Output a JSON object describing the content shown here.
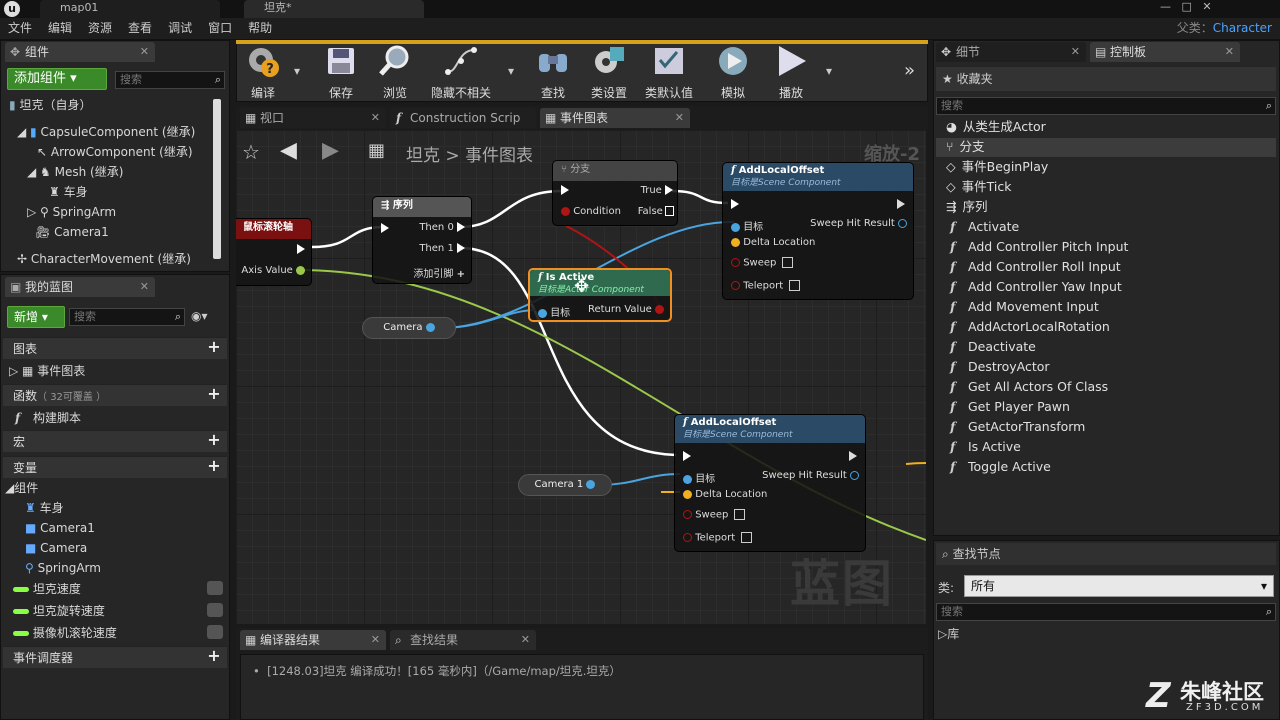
{
  "titlebar": {
    "tab1": "map01",
    "tab2": "坦克*"
  },
  "menu": [
    "文件",
    "编辑",
    "资源",
    "查看",
    "调试",
    "窗口",
    "帮助"
  ],
  "parent_class": {
    "label": "父类：",
    "value": "Character"
  },
  "components_panel": {
    "tab": "组件",
    "add_button": "添加组件",
    "search_placeholder": "搜索",
    "root": "坦克（自身）",
    "items": [
      "CapsuleComponent (继承)",
      "ArrowComponent (继承)",
      "Mesh (继承)",
      "车身",
      "SpringArm",
      "Camera1",
      "CharacterMovement (继承)"
    ]
  },
  "mybp_panel": {
    "tab": "我的蓝图",
    "new_button": "新增",
    "search_placeholder": "搜索",
    "graphs": "图表",
    "event_graph": "事件图表",
    "functions": "函数",
    "functions_note": "（ 32可覆盖 ）",
    "construct": "构建脚本",
    "macros": "宏",
    "variables": "变量",
    "components_cat": "组件",
    "comp_vars": [
      "车身",
      "Camera1",
      "Camera",
      "SpringArm"
    ],
    "vars": [
      "坦克速度",
      "坦克旋转速度",
      "摄像机滚轮速度"
    ],
    "dispatchers": "事件调度器"
  },
  "toolbar": [
    "编译",
    "保存",
    "浏览",
    "隐藏不相关",
    "查找",
    "类设置",
    "类默认值",
    "模拟",
    "播放"
  ],
  "editor_tabs": [
    "视口",
    "Construction Scrip",
    "事件图表"
  ],
  "graph": {
    "breadcrumb_root": "坦克",
    "breadcrumb_sep": ">",
    "breadcrumb_page": "事件图表",
    "zoom": "缩放-2",
    "watermark": "蓝图",
    "nodes": {
      "wheel": {
        "title": "鼠标滚轮轴",
        "pin": "Axis Value"
      },
      "seq": {
        "title": "序列",
        "then0": "Then 0",
        "then1": "Then 1",
        "add": "添加引脚"
      },
      "branch": {
        "title": "分支",
        "cond": "Condition",
        "t": "True",
        "f": "False"
      },
      "isactive": {
        "title": "Is Active",
        "sub": "目标是Actor Component",
        "target": "目标",
        "ret": "Return Value"
      },
      "alo1": {
        "title": "AddLocalOffset",
        "sub": "目标是Scene Component",
        "target": "目标",
        "sweepres": "Sweep Hit Result",
        "delta": "Delta Location",
        "sweep": "Sweep",
        "teleport": "Teleport"
      },
      "alo2": {
        "title": "AddLocalOffset",
        "sub": "目标是Scene Component",
        "target": "目标",
        "sweepres": "Sweep Hit Result",
        "delta": "Delta Location",
        "sweep": "Sweep",
        "teleport": "Teleport"
      },
      "cam": "Camera",
      "cam1": "Camera 1"
    }
  },
  "bottom": {
    "tabs": [
      "编译器结果",
      "查找结果"
    ],
    "log": "[1248.03]坦克 编译成功！[165 毫秒内]（/Game/map/坦克.坦克）"
  },
  "details_tab": "细节",
  "palette": {
    "tab": "控制板",
    "favorites": "收藏夹",
    "search_placeholder": "搜索",
    "items": [
      "从类生成Actor",
      "分支",
      "事件BeginPlay",
      "事件Tick",
      "序列",
      "Activate",
      "Add Controller Pitch Input",
      "Add Controller Roll Input",
      "Add Controller Yaw Input",
      "Add Movement Input",
      "AddActorLocalRotation",
      "Deactivate",
      "DestroyActor",
      "Get All Actors Of Class",
      "Get Player Pawn",
      "GetActorTransform",
      "Is Active",
      "Toggle Active"
    ],
    "find_nodes": "查找节点",
    "category_label": "类:",
    "category_value": "所有",
    "search2_placeholder": "搜索",
    "library": "库"
  },
  "site_logo": {
    "name": "朱峰社区",
    "url": "ZF3D.COM"
  }
}
